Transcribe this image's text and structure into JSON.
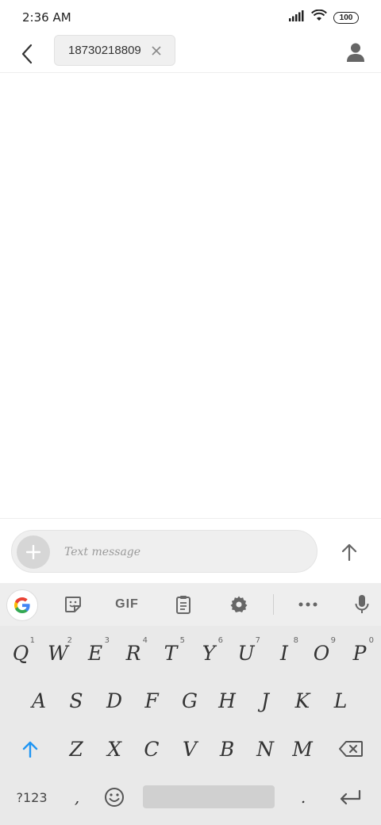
{
  "status_bar": {
    "time": "2:36 AM",
    "battery": "100",
    "icons": [
      "signal-icon",
      "wifi-icon",
      "battery-icon"
    ]
  },
  "app_bar": {
    "recipient": "18730218809",
    "icons": [
      "back-arrow-icon",
      "close-icon",
      "contact-icon"
    ]
  },
  "compose": {
    "placeholder": "Text message",
    "icons": [
      "plus-icon",
      "send-arrow-icon"
    ]
  },
  "keyboard": {
    "toolbar": {
      "gif_label": "GIF",
      "icons": [
        "google-g-icon",
        "sticker-icon",
        "clipboard-icon",
        "settings-gear-icon",
        "more-dots-icon",
        "microphone-icon"
      ]
    },
    "row1": [
      "Q",
      "W",
      "E",
      "R",
      "T",
      "Y",
      "U",
      "I",
      "O",
      "P"
    ],
    "row1_hints": [
      "1",
      "2",
      "3",
      "4",
      "5",
      "6",
      "7",
      "8",
      "9",
      "0"
    ],
    "row2": [
      "A",
      "S",
      "D",
      "F",
      "G",
      "H",
      "J",
      "K",
      "L"
    ],
    "row3": [
      "Z",
      "X",
      "C",
      "V",
      "B",
      "N",
      "M"
    ],
    "symbols_label": "?123",
    "comma": ",",
    "period": ".",
    "accent_color": "#2196f3"
  }
}
